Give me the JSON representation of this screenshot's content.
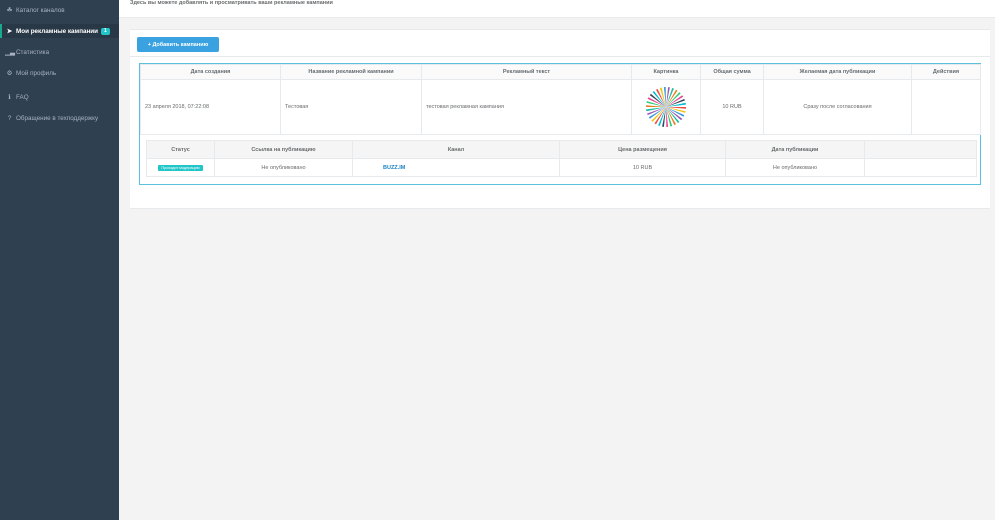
{
  "sidebar": {
    "items": [
      {
        "icon": "☘",
        "label": "Каталог каналов"
      },
      {
        "icon": "➤",
        "label": "Мои рекламные кампании",
        "badge": "1"
      },
      {
        "icon": "▁▃",
        "label": "Статистика"
      },
      {
        "icon": "⚙",
        "label": "Мой профиль"
      },
      {
        "icon": "ℹ",
        "label": "FAQ"
      },
      {
        "icon": "?",
        "label": "Обращение в техподдержку"
      }
    ]
  },
  "page": {
    "intro": "Здесь вы можете добавлять и просматривать ваши рекламные кампании",
    "add_button": "+ Добавить кампанию"
  },
  "campaigns": {
    "headers": [
      "Дата создания",
      "Название рекламной кампании",
      "Рекламный текст",
      "Картинка",
      "Общая сумма",
      "Желаемая дата публикации",
      "Действия"
    ],
    "row": {
      "date": "23 апреля 2018, 07:22:08",
      "name": "Тестовая",
      "text": "тестовая рекламная кампания",
      "total": "10 RUB",
      "desired_date": "Сразу после согласования",
      "actions": ""
    }
  },
  "publications": {
    "headers": [
      "Статус",
      "Ссылка на публикацию",
      "Канал",
      "Цена размещения",
      "Дата публикации",
      ""
    ],
    "row": {
      "status": "Проходит модерацию",
      "link": "Не опубликовано",
      "channel": "BUZZ.IM",
      "price": "10 RUB",
      "pub_date": "Не опубликовано"
    }
  },
  "colors": {
    "sidebar_bg": "#2f4050",
    "accent": "#3aa2e0",
    "badge": "#23c6c8",
    "link": "#1c84c6"
  }
}
